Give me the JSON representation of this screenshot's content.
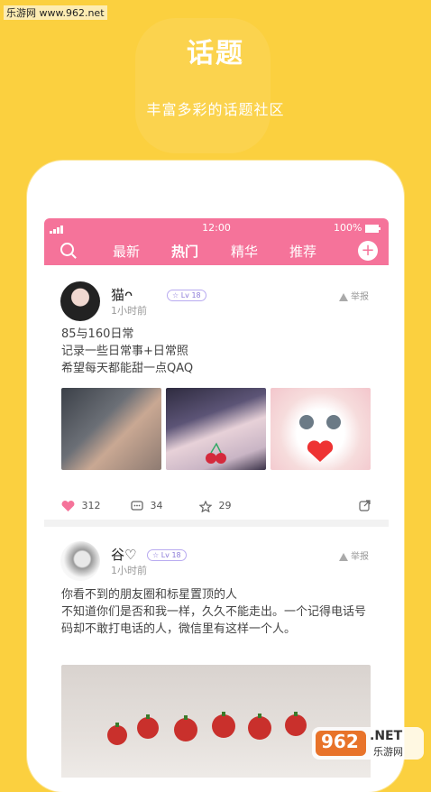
{
  "watermark": "乐游网 www.962.net",
  "hero": {
    "title": "话题",
    "subtitle": "丰富多彩的话题社区"
  },
  "status": {
    "time": "12:00",
    "battery": "100%"
  },
  "tabs": [
    {
      "label": "最新",
      "active": false
    },
    {
      "label": "热门",
      "active": true
    },
    {
      "label": "精华",
      "active": false
    },
    {
      "label": "推荐",
      "active": false
    }
  ],
  "posts": [
    {
      "username": "猫ᴖ",
      "level": "Lv 18",
      "time": "1小时前",
      "report": "举报",
      "text": "85与160日常\n记录一些日常事+日常照\n希望每天都能甜一点QAQ",
      "likes": "312",
      "comments": "34",
      "favorites": "29"
    },
    {
      "username": "谷♡",
      "level": "Lv 18",
      "time": "1小时前",
      "report": "举报",
      "text": "你看不到的朋友圈和标星置顶的人\n不知道你们是否和我一样，久久不能走出。一个记得电话号码却不敢打电话的人，微信里有这样一个人。"
    }
  ],
  "brand_watermark": {
    "logo": "962",
    "suffix": ".NET",
    "sub": "乐游网"
  },
  "colors": {
    "background": "#FBD03F",
    "accent": "#F5739A",
    "like": "#F5739A"
  }
}
